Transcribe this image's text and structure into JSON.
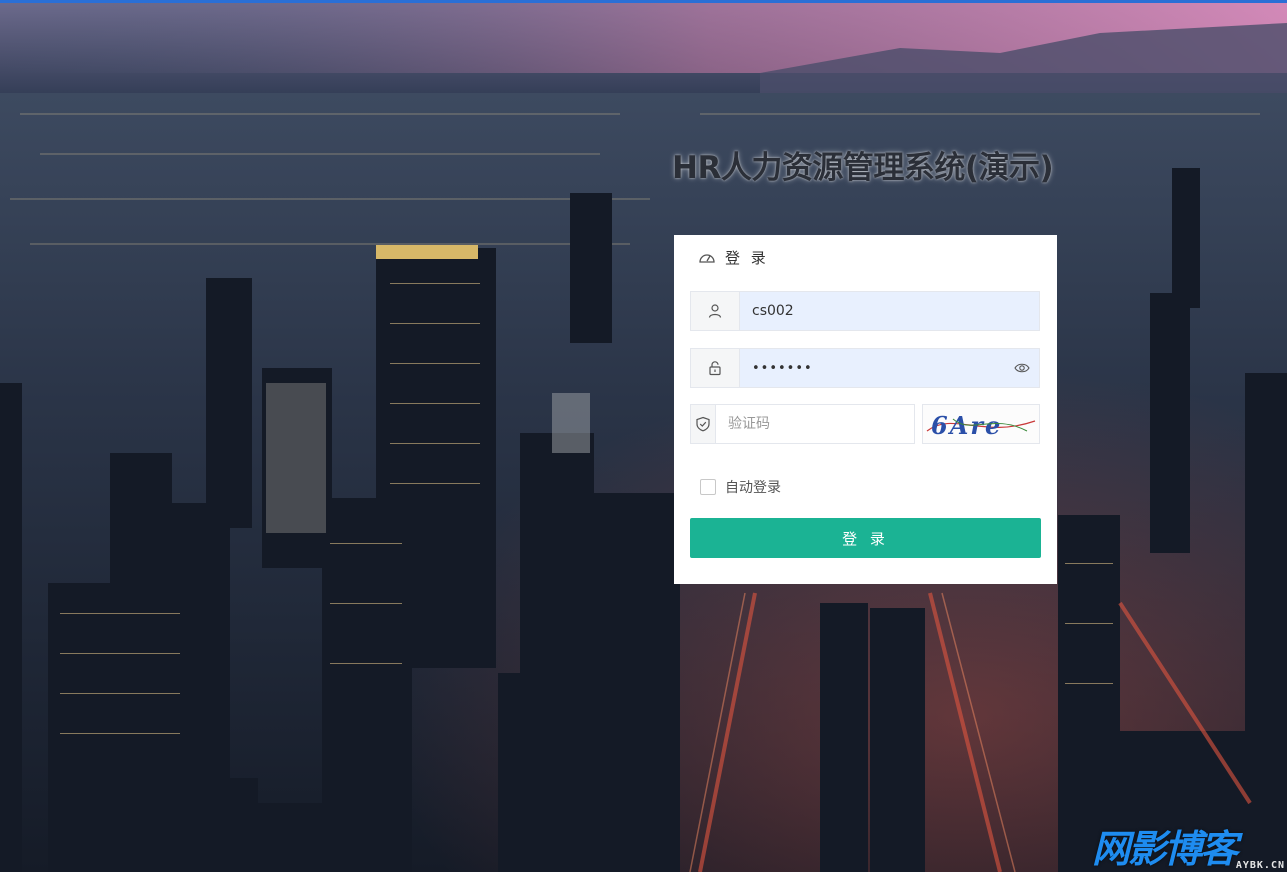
{
  "page": {
    "title": "HR人力资源管理系统(演示)"
  },
  "login_card": {
    "header_title": "登 录",
    "username_value": "cs002",
    "password_value": "•••••••",
    "captcha_placeholder": "验证码",
    "captcha_text": "6Are",
    "remember_label": "自动登录",
    "login_button": "登 录"
  },
  "watermark": {
    "text": "网影博客",
    "subtext": "AYBK.CN"
  },
  "colors": {
    "accent": "#1bb394",
    "autofill_bg": "#e8f0fe",
    "top_bar": "#2a6fd6",
    "watermark": "#1e8cf0"
  },
  "icons": [
    "dashboard-icon",
    "user-icon",
    "lock-icon",
    "eye-icon",
    "shield-icon",
    "checkbox-icon"
  ]
}
